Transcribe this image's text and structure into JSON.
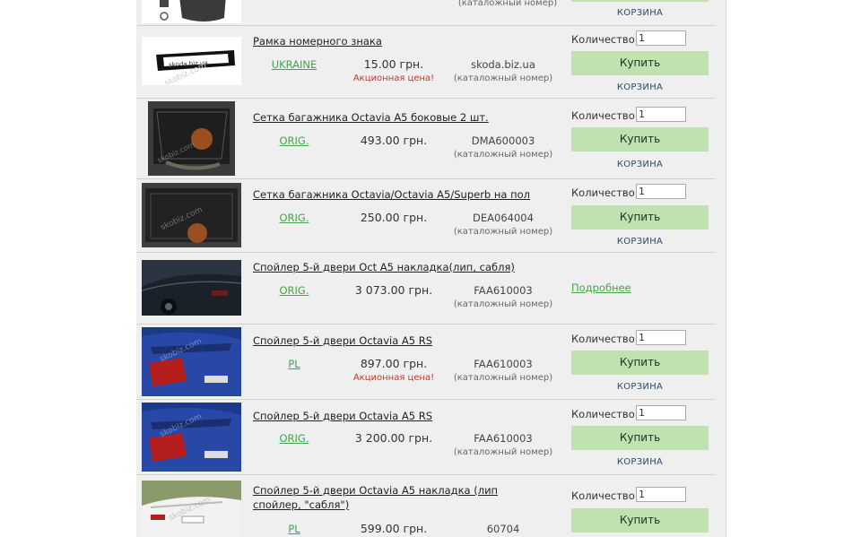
{
  "labels": {
    "catalog_number": "(каталожный номер)",
    "quantity": "Количество:",
    "buy": "Купить",
    "cart": "КОРЗИНА",
    "promo": "Акционная цена!",
    "more": "Подробнее"
  },
  "products": [
    {
      "name": "",
      "catalog_label": "(каталожный номер)",
      "cart": "КОРЗИНА"
    },
    {
      "name": "Рамка номерного знака",
      "brand": "UKRAINE",
      "price": "15.00 грн.",
      "promo": "Акционная цена!",
      "catalog_no": "skoda.biz.ua",
      "catalog_label": "(каталожный номер)",
      "quantity": "1",
      "buy": "Купить",
      "cart": "КОРЗИНА",
      "image": "license-plate-frame"
    },
    {
      "name": "Сетка багажника Octavia A5 боковые 2 шт.",
      "brand": "ORIG.",
      "price": "493.00 грн.",
      "catalog_no": "DMA600003",
      "catalog_label": "(каталожный номер)",
      "quantity": "1",
      "buy": "Купить",
      "cart": "КОРЗИНА",
      "image": "trunk-net-side"
    },
    {
      "name": "Сетка багажника Octavia/Octavia A5/Superb на пол",
      "brand": "ORIG.",
      "price": "250.00 грн.",
      "catalog_no": "DEA064004",
      "catalog_label": "(каталожный номер)",
      "quantity": "1",
      "buy": "Купить",
      "cart": "КОРЗИНА",
      "image": "trunk-net-floor"
    },
    {
      "name": "Спойлер 5-й двери Oct A5 накладка(лип, сабля)",
      "brand": "ORIG.",
      "price": "3 073.00 грн.",
      "catalog_no": "FAA610003",
      "catalog_label": "(каталожный номер)",
      "more": "Подробнее",
      "image": "dark-car-rear"
    },
    {
      "name": "Спойлер 5-й двери Octavia A5 RS",
      "brand": "PL",
      "price": "897.00 грн.",
      "promo": "Акционная цена!",
      "catalog_no": "FAA610003",
      "catalog_label": "(каталожный номер)",
      "quantity": "1",
      "buy": "Купить",
      "cart": "КОРЗИНА",
      "image": "blue-car-spoiler"
    },
    {
      "name": "Спойлер 5-й двери Octavia A5 RS",
      "brand": "ORIG.",
      "price": "3 200.00 грн.",
      "catalog_no": "FAA610003",
      "catalog_label": "(каталожный номер)",
      "quantity": "1",
      "buy": "Купить",
      "cart": "КОРЗИНА",
      "image": "blue-car-spoiler"
    },
    {
      "name": "Спойлер 5-й двери Octavia A5 накладка (лип спойлер, \"сабля\")",
      "brand": "PL",
      "price": "599.00 грн.",
      "catalog_no": "60704",
      "quantity": "1",
      "buy": "Купить",
      "image": "white-car-rear"
    }
  ],
  "watermark": "skobiz.com",
  "colors": {
    "brand_link": "#45a34c",
    "buy_button": "#bfe2b0",
    "promo": "#c0392b",
    "cart": "#2b4a66",
    "panel": "#efefef"
  }
}
